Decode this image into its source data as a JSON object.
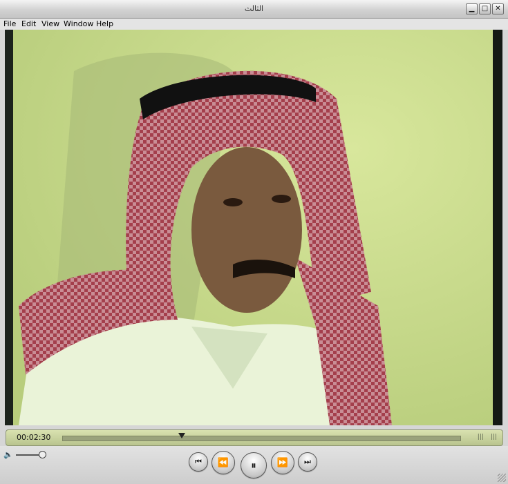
{
  "window": {
    "title": "الثالث",
    "buttons": {
      "minimize": "▁",
      "maximize": "□",
      "close": "✕"
    }
  },
  "menu": {
    "items": [
      "File",
      "Edit",
      "View",
      "Window",
      "Help"
    ]
  },
  "video": {
    "description_icon": "video-frame"
  },
  "timeline": {
    "timecode": "00:02:30",
    "playhead_fraction": 0.3
  },
  "controls": {
    "volume_level": 0.85,
    "icons": {
      "skip_back": "⏮",
      "rewind": "⏪",
      "pause": "⏸",
      "fast_forward": "⏩",
      "skip_forward": "⏭",
      "volume": "🔈"
    }
  },
  "colors": {
    "timeline_bg": "#c8d19d",
    "wall": "#c9dc8c",
    "shemagh_red": "#b0505a"
  }
}
